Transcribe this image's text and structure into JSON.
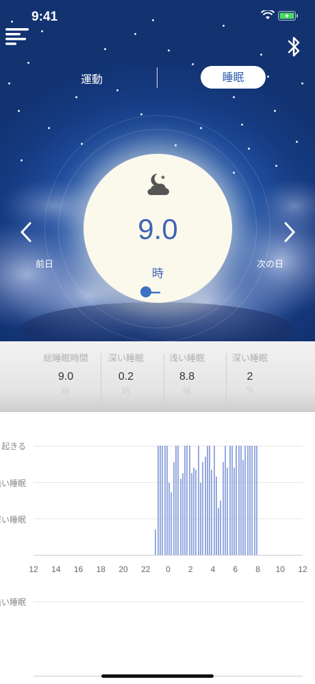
{
  "status_bar": {
    "time": "9:41"
  },
  "mode_toggle": {
    "exercise": "運動",
    "sleep": "睡眠",
    "active": "sleep"
  },
  "dial": {
    "value": "9.0",
    "unit": "時",
    "icon": "moon-cloud-icon"
  },
  "nav": {
    "prev_label": "前日",
    "next_label": "次の日"
  },
  "stats": [
    {
      "label": "総睡眠時間",
      "value": "9.0",
      "unit": "時"
    },
    {
      "label": "深い睡眠",
      "value": "0.2",
      "unit": "時"
    },
    {
      "label": "浅い睡眠",
      "value": "8.8",
      "unit": "時"
    },
    {
      "label": "深い睡眠",
      "value": "2",
      "unit": "%"
    }
  ],
  "chart_data": {
    "type": "bar",
    "y_levels": [
      "起きる",
      "浅い睡眠",
      "深い睡眠"
    ],
    "x_ticks": [
      "12",
      "14",
      "16",
      "18",
      "20",
      "22",
      "0",
      "2",
      "4",
      "6",
      "8",
      "10",
      "12"
    ],
    "xlim_hours": [
      12,
      36
    ],
    "series_color": "#95a8df",
    "bars": [
      {
        "h": 22.9,
        "v": 0.23
      },
      {
        "h": 23.1,
        "v": 1.0
      },
      {
        "h": 23.3,
        "v": 1.0
      },
      {
        "h": 23.5,
        "v": 1.0
      },
      {
        "h": 23.7,
        "v": 1.0
      },
      {
        "h": 23.9,
        "v": 1.0
      },
      {
        "h": 24.1,
        "v": 0.66
      },
      {
        "h": 24.3,
        "v": 0.57
      },
      {
        "h": 24.5,
        "v": 0.85
      },
      {
        "h": 24.7,
        "v": 1.0
      },
      {
        "h": 24.9,
        "v": 1.0
      },
      {
        "h": 25.1,
        "v": 0.7
      },
      {
        "h": 25.3,
        "v": 0.75
      },
      {
        "h": 25.5,
        "v": 1.0
      },
      {
        "h": 25.7,
        "v": 1.0
      },
      {
        "h": 25.9,
        "v": 1.0
      },
      {
        "h": 26.1,
        "v": 0.75
      },
      {
        "h": 26.3,
        "v": 0.8
      },
      {
        "h": 26.5,
        "v": 0.78
      },
      {
        "h": 26.7,
        "v": 1.0
      },
      {
        "h": 26.9,
        "v": 0.66
      },
      {
        "h": 27.1,
        "v": 0.85
      },
      {
        "h": 27.3,
        "v": 0.9
      },
      {
        "h": 27.5,
        "v": 1.0
      },
      {
        "h": 27.7,
        "v": 1.0
      },
      {
        "h": 27.9,
        "v": 0.78
      },
      {
        "h": 28.1,
        "v": 1.0
      },
      {
        "h": 28.3,
        "v": 0.72
      },
      {
        "h": 28.5,
        "v": 0.43
      },
      {
        "h": 28.7,
        "v": 0.5
      },
      {
        "h": 28.9,
        "v": 0.85
      },
      {
        "h": 29.1,
        "v": 1.0
      },
      {
        "h": 29.3,
        "v": 0.8
      },
      {
        "h": 29.5,
        "v": 1.0
      },
      {
        "h": 29.7,
        "v": 1.0
      },
      {
        "h": 29.9,
        "v": 0.8
      },
      {
        "h": 30.1,
        "v": 1.0
      },
      {
        "h": 30.3,
        "v": 1.0
      },
      {
        "h": 30.5,
        "v": 1.0
      },
      {
        "h": 30.7,
        "v": 0.87
      },
      {
        "h": 30.9,
        "v": 1.0
      },
      {
        "h": 31.1,
        "v": 1.0
      },
      {
        "h": 31.3,
        "v": 1.0
      },
      {
        "h": 31.5,
        "v": 1.0
      },
      {
        "h": 31.7,
        "v": 1.0
      },
      {
        "h": 31.9,
        "v": 1.0
      }
    ],
    "second_chart_y_levels": [
      "浅い睡眠"
    ]
  }
}
